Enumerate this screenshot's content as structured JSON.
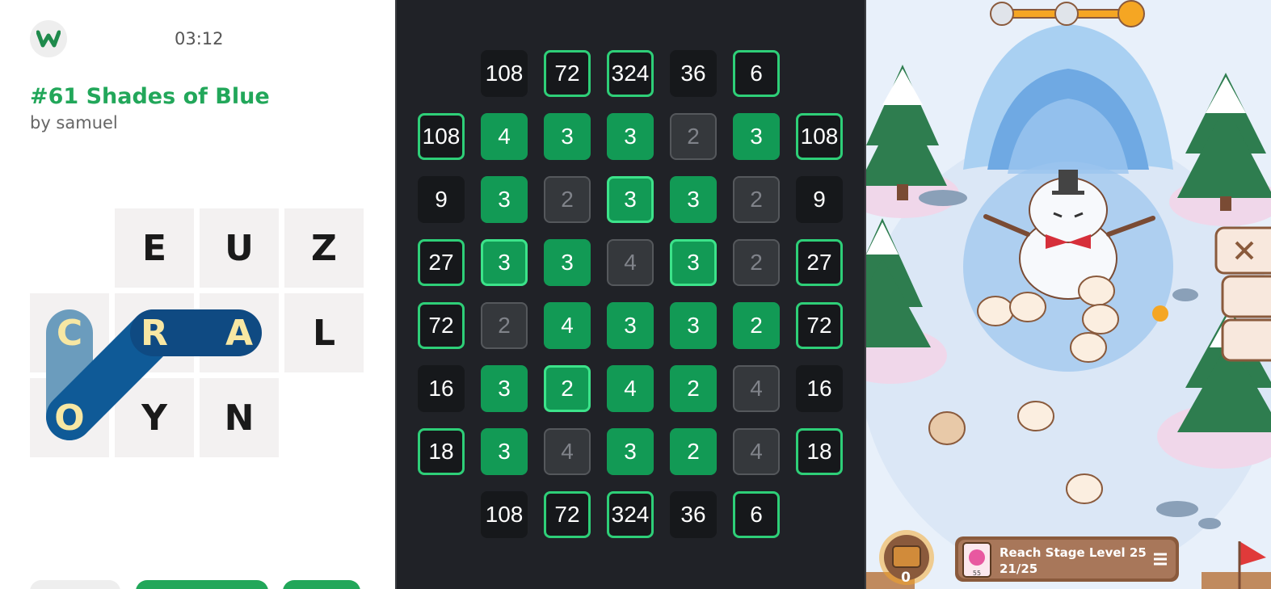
{
  "word_game": {
    "logo_letter": "W",
    "timer": "03:12",
    "title": "#61 Shades of Blue",
    "byline": "by samuel",
    "tiles": [
      {
        "row": 0,
        "col": 1,
        "letter": "E",
        "selected": false
      },
      {
        "row": 0,
        "col": 2,
        "letter": "U",
        "selected": false
      },
      {
        "row": 0,
        "col": 3,
        "letter": "Z",
        "selected": false
      },
      {
        "row": 1,
        "col": 0,
        "letter": "C",
        "selected": true
      },
      {
        "row": 1,
        "col": 1,
        "letter": "R",
        "selected": true
      },
      {
        "row": 1,
        "col": 2,
        "letter": "A",
        "selected": true
      },
      {
        "row": 1,
        "col": 3,
        "letter": "L",
        "selected": false
      },
      {
        "row": 2,
        "col": 0,
        "letter": "O",
        "selected": true
      },
      {
        "row": 2,
        "col": 1,
        "letter": "Y",
        "selected": false
      },
      {
        "row": 2,
        "col": 2,
        "letter": "N",
        "selected": false
      }
    ]
  },
  "number_grid": {
    "top_clues": [
      {
        "value": "108",
        "done": false
      },
      {
        "value": "72",
        "done": true
      },
      {
        "value": "324",
        "done": true
      },
      {
        "value": "36",
        "done": false
      },
      {
        "value": "6",
        "done": true
      }
    ],
    "bottom_clues": [
      {
        "value": "108",
        "done": false
      },
      {
        "value": "72",
        "done": true
      },
      {
        "value": "324",
        "done": true
      },
      {
        "value": "36",
        "done": false
      },
      {
        "value": "6",
        "done": true
      }
    ],
    "rows": [
      {
        "left": "108",
        "right": "108",
        "done": true,
        "cells": [
          {
            "v": "4",
            "s": "on"
          },
          {
            "v": "3",
            "s": "on"
          },
          {
            "v": "3",
            "s": "on"
          },
          {
            "v": "2",
            "s": "off"
          },
          {
            "v": "3",
            "s": "on"
          }
        ]
      },
      {
        "left": "9",
        "right": "9",
        "done": false,
        "cells": [
          {
            "v": "3",
            "s": "on"
          },
          {
            "v": "2",
            "s": "off"
          },
          {
            "v": "3",
            "s": "on-ok"
          },
          {
            "v": "3",
            "s": "on"
          },
          {
            "v": "2",
            "s": "off"
          }
        ]
      },
      {
        "left": "27",
        "right": "27",
        "done": true,
        "cells": [
          {
            "v": "3",
            "s": "on-ok"
          },
          {
            "v": "3",
            "s": "on"
          },
          {
            "v": "4",
            "s": "off"
          },
          {
            "v": "3",
            "s": "on-ok"
          },
          {
            "v": "2",
            "s": "off"
          }
        ]
      },
      {
        "left": "72",
        "right": "72",
        "done": true,
        "cells": [
          {
            "v": "2",
            "s": "off"
          },
          {
            "v": "4",
            "s": "on"
          },
          {
            "v": "3",
            "s": "on"
          },
          {
            "v": "3",
            "s": "on"
          },
          {
            "v": "2",
            "s": "on"
          }
        ]
      },
      {
        "left": "16",
        "right": "16",
        "done": false,
        "cells": [
          {
            "v": "3",
            "s": "on"
          },
          {
            "v": "2",
            "s": "on-ok"
          },
          {
            "v": "4",
            "s": "on"
          },
          {
            "v": "2",
            "s": "on"
          },
          {
            "v": "4",
            "s": "off"
          }
        ]
      },
      {
        "left": "18",
        "right": "18",
        "done": true,
        "cells": [
          {
            "v": "3",
            "s": "on"
          },
          {
            "v": "4",
            "s": "off"
          },
          {
            "v": "3",
            "s": "on"
          },
          {
            "v": "2",
            "s": "on"
          },
          {
            "v": "4",
            "s": "off"
          }
        ]
      }
    ]
  },
  "cat_game": {
    "quest_title": "Reach Stage Level 25",
    "quest_progress": "21/25",
    "chest_count": "0",
    "card_count": "55",
    "colors": {
      "snow": "#e9f1fb",
      "ice": "#9cc8f0",
      "tree": "#2e7d4f",
      "panel": "#6d4c41",
      "gold": "#f5a623"
    }
  }
}
